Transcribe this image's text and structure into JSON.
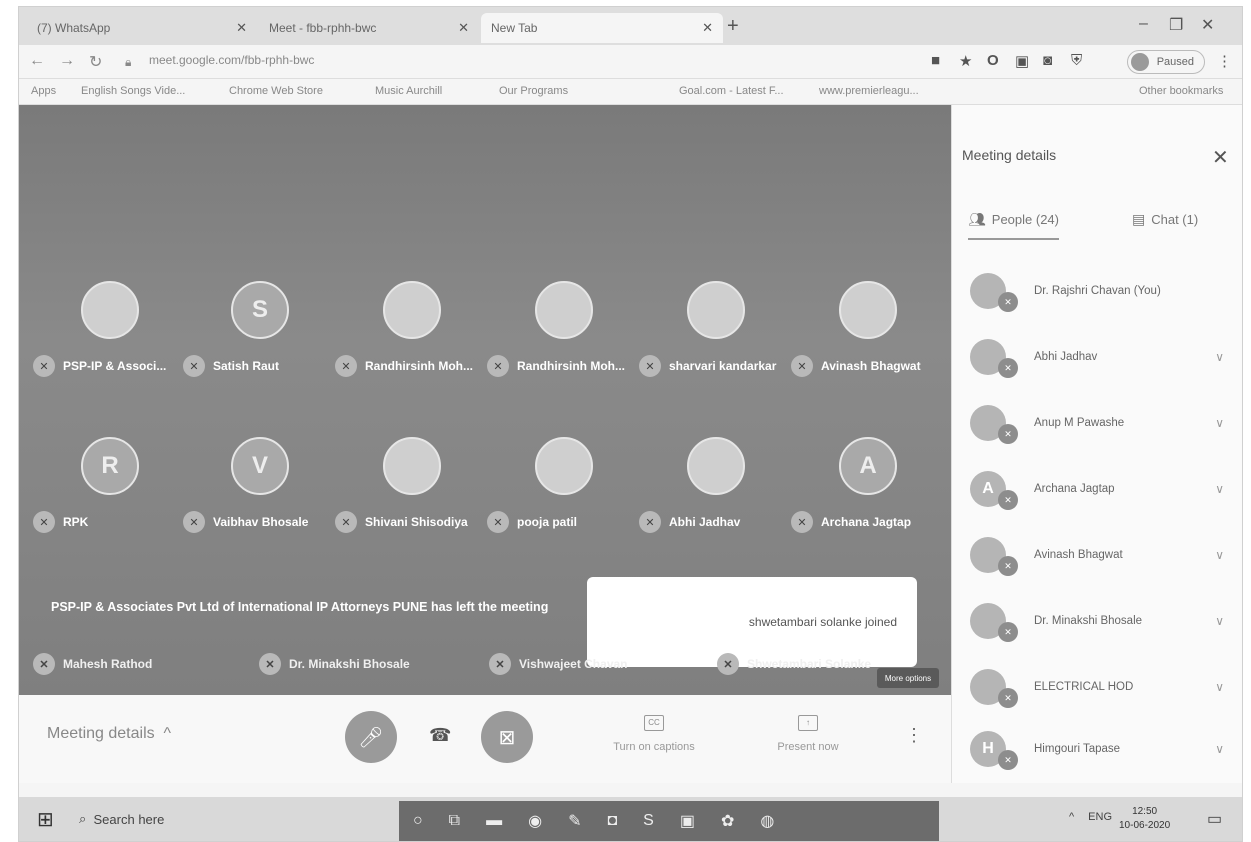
{
  "browser": {
    "tabs": [
      {
        "title": "(7) WhatsApp"
      },
      {
        "title": "Meet - fbb-rphh-bwc"
      },
      {
        "title": "New Tab"
      }
    ],
    "url": "meet.google.com/fbb-rphh-bwc",
    "profile_label": "Paused",
    "bookmarks": [
      "Apps",
      "English Songs Vide...",
      "Chrome Web Store",
      "Music Aurchill",
      "Our Programs",
      "Goal.com - Latest F...",
      "www.premierleagu...",
      "Other bookmarks"
    ]
  },
  "meeting": {
    "tiles_row1": [
      {
        "name": "PSP-IP & Associ...",
        "initial": ""
      },
      {
        "name": "Satish Raut",
        "initial": "S"
      },
      {
        "name": "Randhirsinh Moh...",
        "initial": ""
      },
      {
        "name": "Randhirsinh Moh...",
        "initial": ""
      },
      {
        "name": "sharvari kandarkar",
        "initial": ""
      },
      {
        "name": "Avinash Bhagwat",
        "initial": ""
      }
    ],
    "tiles_row2": [
      {
        "name": "RPK",
        "initial": "R"
      },
      {
        "name": "Vaibhav Bhosale",
        "initial": "V"
      },
      {
        "name": "Shivani Shisodiya",
        "initial": ""
      },
      {
        "name": "pooja patil",
        "initial": ""
      },
      {
        "name": "Abhi Jadhav",
        "initial": ""
      },
      {
        "name": "Archana Jagtap",
        "initial": "A"
      }
    ],
    "tiles_row3": [
      "Mahesh Rathod",
      "Dr. Minakshi Bhosale",
      "Vishwajeet Chavan",
      "Shwetambari Solanke"
    ],
    "left_message": "PSP-IP & Associates Pvt Ltd of International IP Attorneys PUNE has left the meeting",
    "toast": "shwetambari solanke joined",
    "more_options": "More options"
  },
  "controls": {
    "meeting_details": "Meeting details",
    "captions": "Turn on captions",
    "present": "Present now"
  },
  "panel": {
    "title": "Meeting details",
    "people_tab": "People (24)",
    "chat_tab": "Chat (1)",
    "people": [
      {
        "name": "Dr. Rajshri Chavan (You)",
        "initial": ""
      },
      {
        "name": "Abhi Jadhav",
        "initial": ""
      },
      {
        "name": "Anup M Pawashe",
        "initial": ""
      },
      {
        "name": "Archana Jagtap",
        "initial": "A"
      },
      {
        "name": "Avinash Bhagwat",
        "initial": ""
      },
      {
        "name": "Dr. Minakshi Bhosale",
        "initial": ""
      },
      {
        "name": "ELECTRICAL HOD",
        "initial": ""
      },
      {
        "name": "Himgouri Tapase",
        "initial": "H"
      }
    ]
  },
  "taskbar": {
    "search": "Search here",
    "lang": "ENG",
    "time": "12:50",
    "date": "10-06-2020"
  }
}
